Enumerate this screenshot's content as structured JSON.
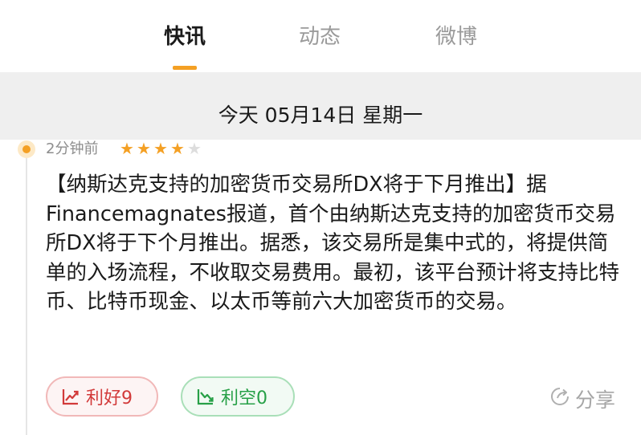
{
  "tabs": [
    {
      "label": "快讯",
      "active": true
    },
    {
      "label": "动态",
      "active": false
    },
    {
      "label": "微博",
      "active": false
    }
  ],
  "date_header": "今天 05月14日 星期一",
  "item": {
    "time": "2分钟前",
    "rating": {
      "value": 4,
      "max": 5
    },
    "content": "【纳斯达克支持的加密货币交易所DX将于下月推出】据Financemagnates报道，首个由纳斯达克支持的加密货币交易所DX将于下个月推出。据悉，该交易所是集中式的，将提供简单的入场流程，不收取交易费用。最初，该平台预计将支持比特币、比特币现金、以太币等前六大加密货币的交易。",
    "bullish": {
      "label": "利好9",
      "icon": "trend-up-icon"
    },
    "bearish": {
      "label": "利空0",
      "icon": "trend-down-icon"
    },
    "share": {
      "label": "分享",
      "icon": "share-icon"
    }
  },
  "colors": {
    "accent": "#f4a024",
    "bullish": "#d23a3a",
    "bearish": "#27a047",
    "muted": "#8d8d8d"
  }
}
